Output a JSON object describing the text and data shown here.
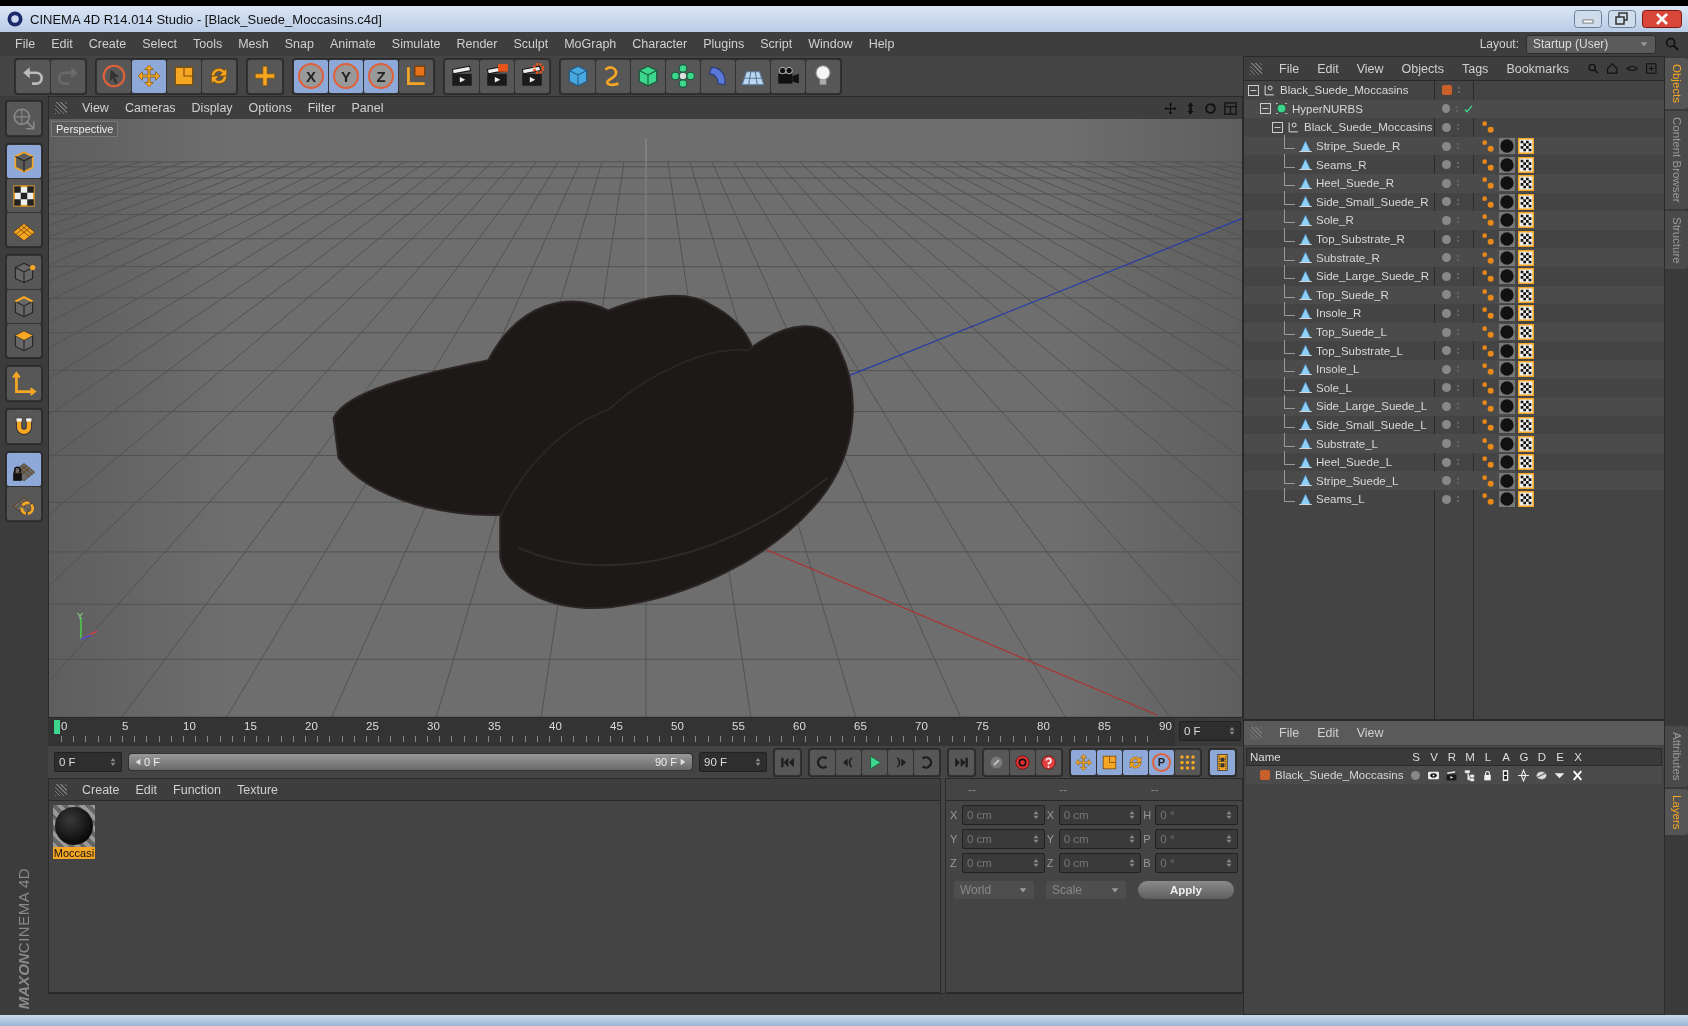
{
  "window": {
    "title": "CINEMA 4D R14.014 Studio - [Black_Suede_Moccasins.c4d]"
  },
  "menu": [
    "File",
    "Edit",
    "Create",
    "Select",
    "Tools",
    "Mesh",
    "Snap",
    "Animate",
    "Simulate",
    "Render",
    "Sculpt",
    "MoGraph",
    "Character",
    "Plugins",
    "Script",
    "Window",
    "Help"
  ],
  "layout": {
    "label": "Layout:",
    "value": "Startup (User)"
  },
  "main_toolbar": [
    {
      "selected": false
    },
    {
      "selected": false
    },
    {
      "selected": false
    },
    {
      "selected": true
    },
    {
      "selected": false
    },
    {
      "selected": false
    },
    {
      "selected": false
    },
    {
      "label": "X",
      "selected": true
    },
    {
      "label": "Y",
      "selected": true
    },
    {
      "label": "Z",
      "selected": true
    },
    {
      "selected": false
    },
    {
      "selected": false
    },
    {
      "selected": false
    },
    {
      "selected": false
    },
    {
      "selected": false
    },
    {
      "selected": false
    },
    {
      "selected": false
    },
    {
      "selected": false
    },
    {
      "selected": false
    },
    {
      "selected": false
    },
    {
      "selected": false
    },
    {
      "selected": false
    }
  ],
  "left_toolbar": [
    {
      "selected": false
    },
    {
      "selected": true
    },
    {
      "selected": false
    },
    {
      "selected": false
    },
    {
      "selected": false
    },
    {
      "selected": false
    },
    {
      "selected": false
    },
    {
      "selected": false
    },
    {
      "selected": false
    },
    {
      "selected": true
    },
    {
      "selected": false
    }
  ],
  "logo": {
    "brand": "MAXON",
    "product": "CINEMA 4D"
  },
  "viewport": {
    "menu": [
      "View",
      "Cameras",
      "Display",
      "Options",
      "Filter",
      "Panel"
    ],
    "camera_label": "Perspective",
    "gizmo_label": "Y"
  },
  "timeline": {
    "ticks": [
      "0",
      "5",
      "10",
      "15",
      "20",
      "25",
      "30",
      "35",
      "40",
      "45",
      "50",
      "55",
      "60",
      "65",
      "70",
      "75",
      "80",
      "85",
      "90"
    ],
    "playhead": {
      "level": 0
    },
    "current_frame": "0 F"
  },
  "frame_range": {
    "level": 1,
    "start": "0 F",
    "range_start": "0 F",
    "range_end": "90 F",
    "end": "90 F"
  },
  "key_buttons": [
    {
      "selected": true
    },
    {
      "selected": true
    },
    {
      "selected": true
    },
    {
      "label": "P",
      "selected": true
    },
    {
      "selected": false
    }
  ],
  "materials": {
    "menu": [
      "Create",
      "Edit",
      "Function",
      "Texture"
    ],
    "items": [
      {
        "name": "Moccasi",
        "selected": true
      }
    ]
  },
  "coordinates": {
    "headers": [
      "--",
      "--",
      "--"
    ],
    "rows": [
      {
        "axis": "X",
        "position": "0 cm",
        "size_axis": "X",
        "size": "0 cm",
        "rotation_axis": "H",
        "rotation": "0 °"
      },
      {
        "axis": "Y",
        "position": "0 cm",
        "size_axis": "Y",
        "size": "0 cm",
        "rotation_axis": "P",
        "rotation": "0 °"
      },
      {
        "axis": "Z",
        "position": "0 cm",
        "size_axis": "Z",
        "size": "0 cm",
        "rotation_axis": "B",
        "rotation": "0 °"
      }
    ],
    "mode": "World",
    "size_mode": "Scale",
    "apply": "Apply"
  },
  "objects": {
    "menu": [
      "File",
      "Edit",
      "View",
      "Objects",
      "Tags",
      "Bookmarks"
    ],
    "tree": [
      {
        "name": "Black_Suede_Moccasins",
        "kind": "null",
        "color": "#c8602a",
        "expanded": true,
        "children": [
          {
            "name": "HyperNURBS",
            "kind": "hypernurbs",
            "enabled": true,
            "expanded": true,
            "children": [
              {
                "name": "Black_Suede_Moccasins",
                "kind": "null",
                "expanded": true,
                "tags": [
                  {
                    "kind": "phong"
                  }
                ],
                "children": [
                  {
                    "name": "Stripe_Suede_R",
                    "kind": "polygon",
                    "tags": [
                      {
                        "kind": "phong"
                      },
                      {
                        "kind": "material"
                      },
                      {
                        "kind": "uvw"
                      }
                    ]
                  },
                  {
                    "name": "Seams_R",
                    "kind": "polygon",
                    "tags": [
                      {
                        "kind": "phong"
                      },
                      {
                        "kind": "material"
                      },
                      {
                        "kind": "uvw"
                      }
                    ]
                  },
                  {
                    "name": "Heel_Suede_R",
                    "kind": "polygon",
                    "tags": [
                      {
                        "kind": "phong"
                      },
                      {
                        "kind": "material"
                      },
                      {
                        "kind": "uvw"
                      }
                    ]
                  },
                  {
                    "name": "Side_Small_Suede_R",
                    "kind": "polygon",
                    "tags": [
                      {
                        "kind": "phong"
                      },
                      {
                        "kind": "material"
                      },
                      {
                        "kind": "uvw"
                      }
                    ]
                  },
                  {
                    "name": "Sole_R",
                    "kind": "polygon",
                    "tags": [
                      {
                        "kind": "phong"
                      },
                      {
                        "kind": "material"
                      },
                      {
                        "kind": "uvw"
                      }
                    ]
                  },
                  {
                    "name": "Top_Substrate_R",
                    "kind": "polygon",
                    "tags": [
                      {
                        "kind": "phong"
                      },
                      {
                        "kind": "material"
                      },
                      {
                        "kind": "uvw"
                      }
                    ]
                  },
                  {
                    "name": "Substrate_R",
                    "kind": "polygon",
                    "tags": [
                      {
                        "kind": "phong"
                      },
                      {
                        "kind": "material"
                      },
                      {
                        "kind": "uvw"
                      }
                    ]
                  },
                  {
                    "name": "Side_Large_Suede_R",
                    "kind": "polygon",
                    "tags": [
                      {
                        "kind": "phong"
                      },
                      {
                        "kind": "material"
                      },
                      {
                        "kind": "uvw"
                      }
                    ]
                  },
                  {
                    "name": "Top_Suede_R",
                    "kind": "polygon",
                    "tags": [
                      {
                        "kind": "phong"
                      },
                      {
                        "kind": "material"
                      },
                      {
                        "kind": "uvw"
                      }
                    ]
                  },
                  {
                    "name": "Insole_R",
                    "kind": "polygon",
                    "tags": [
                      {
                        "kind": "phong"
                      },
                      {
                        "kind": "material"
                      },
                      {
                        "kind": "uvw"
                      }
                    ]
                  },
                  {
                    "name": "Top_Suede_L",
                    "kind": "polygon",
                    "tags": [
                      {
                        "kind": "phong"
                      },
                      {
                        "kind": "material"
                      },
                      {
                        "kind": "uvw"
                      }
                    ]
                  },
                  {
                    "name": "Top_Substrate_L",
                    "kind": "polygon",
                    "tags": [
                      {
                        "kind": "phong"
                      },
                      {
                        "kind": "material"
                      },
                      {
                        "kind": "uvw"
                      }
                    ]
                  },
                  {
                    "name": "Insole_L",
                    "kind": "polygon",
                    "tags": [
                      {
                        "kind": "phong"
                      },
                      {
                        "kind": "material"
                      },
                      {
                        "kind": "uvw"
                      }
                    ]
                  },
                  {
                    "name": "Sole_L",
                    "kind": "polygon",
                    "tags": [
                      {
                        "kind": "phong"
                      },
                      {
                        "kind": "material"
                      },
                      {
                        "kind": "uvw"
                      }
                    ]
                  },
                  {
                    "name": "Side_Large_Suede_L",
                    "kind": "polygon",
                    "tags": [
                      {
                        "kind": "phong"
                      },
                      {
                        "kind": "material"
                      },
                      {
                        "kind": "uvw"
                      }
                    ]
                  },
                  {
                    "name": "Side_Small_Suede_L",
                    "kind": "polygon",
                    "tags": [
                      {
                        "kind": "phong"
                      },
                      {
                        "kind": "material"
                      },
                      {
                        "kind": "uvw"
                      }
                    ]
                  },
                  {
                    "name": "Substrate_L",
                    "kind": "polygon",
                    "tags": [
                      {
                        "kind": "phong"
                      },
                      {
                        "kind": "material"
                      },
                      {
                        "kind": "uvw"
                      }
                    ]
                  },
                  {
                    "name": "Heel_Suede_L",
                    "kind": "polygon",
                    "tags": [
                      {
                        "kind": "phong"
                      },
                      {
                        "kind": "material"
                      },
                      {
                        "kind": "uvw"
                      }
                    ]
                  },
                  {
                    "name": "Stripe_Suede_L",
                    "kind": "polygon",
                    "tags": [
                      {
                        "kind": "phong"
                      },
                      {
                        "kind": "material"
                      },
                      {
                        "kind": "uvw"
                      }
                    ]
                  },
                  {
                    "name": "Seams_L",
                    "kind": "polygon",
                    "tags": [
                      {
                        "kind": "phong"
                      },
                      {
                        "kind": "material"
                      },
                      {
                        "kind": "uvw"
                      }
                    ]
                  }
                ]
              }
            ]
          }
        ]
      }
    ]
  },
  "layers": {
    "menu": [
      "File",
      "Edit",
      "View"
    ],
    "columns": [
      "Name",
      "S",
      "V",
      "R",
      "M",
      "L",
      "A",
      "G",
      "D",
      "E",
      "X"
    ],
    "rows": [
      {
        "name": "Black_Suede_Moccasins",
        "color": "#c8602a"
      }
    ]
  },
  "side_tabs": {
    "upper": [
      {
        "label": "Objects",
        "selected": true
      },
      {
        "label": "Content Browser",
        "selected": false
      },
      {
        "label": "Structure",
        "selected": false
      }
    ],
    "lower": [
      {
        "label": "Attributes",
        "selected": false
      },
      {
        "label": "Layers",
        "selected": true
      }
    ]
  }
}
